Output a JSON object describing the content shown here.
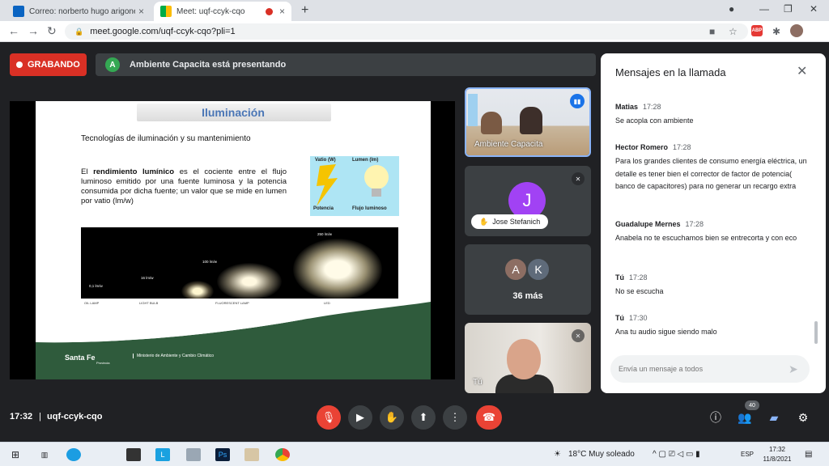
{
  "browser": {
    "tabs": [
      {
        "title": "Correo: norberto hugo arigone -",
        "active": false
      },
      {
        "title": "Meet: uqf-ccyk-cqo",
        "active": true
      }
    ],
    "url": "meet.google.com/uqf-ccyk-cqo?pli=1",
    "abp_label": "ABP"
  },
  "meet": {
    "recording_label": "GRABANDO",
    "presenter_initial": "A",
    "presenting_text": "Ambiente Capacita está presentando",
    "slide": {
      "title": "Iluminación",
      "subtitle": "Tecnologías de iluminación y su mantenimiento",
      "body_prefix": "El ",
      "body_bold": "rendimiento lumínico",
      "body_rest": " es el cociente entre el flujo luminoso emitido por una fuente luminosa y la potencia consumida por dicha fuente; un valor que se mide en lumen por vatio (lm/w)",
      "diagram": {
        "watts": "Vatio (W)",
        "lumen": "Lumen (lm)",
        "power": "Potencia",
        "flux": "Flujo luminoso"
      },
      "lamps": {
        "values": [
          "0,1 lm/w",
          "16 lm/w",
          "100 lm/w",
          "250 lm/w"
        ],
        "names": [
          "OIL LAMP",
          "LIGHT BULB",
          "FLUORESCENT LAMP",
          "LED"
        ]
      },
      "footer_logo": "Santa Fe",
      "footer_logo_sub": "Provincia",
      "footer_ministry": "Ministerio de Ambiente y Cambio Climático"
    },
    "tiles": [
      {
        "label": "Ambiente Capacita"
      },
      {
        "initial": "J",
        "name": "Jose Stefanich"
      },
      {
        "initials": [
          "A",
          "K"
        ],
        "more": "36 más"
      },
      {
        "label": "Tú"
      }
    ],
    "chat": {
      "title": "Mensajes en la llamada",
      "messages": [
        {
          "sender": "Matias",
          "time": "17:28",
          "text": "Se acopla con ambiente"
        },
        {
          "sender": "Hector Romero",
          "time": "17:28",
          "text": "Para los grandes clientes de consumo energía eléctrica, un detalle es tener bien el corrector de factor de potencia( banco de capacitores) para no generar un recargo extra"
        },
        {
          "sender": "Guadalupe Mernes",
          "time": "17:28",
          "text": "Anabela no te escuchamos bien se entrecorta y con eco"
        },
        {
          "sender": "Tú",
          "time": "17:28",
          "text": "No se escucha"
        },
        {
          "sender": "Tú",
          "time": "17:30",
          "text": "Ana tu audio sigue siendo malo"
        }
      ],
      "input_placeholder": "Envía un mensaje a todos"
    },
    "bottom": {
      "time": "17:32",
      "separator": "|",
      "meeting_code": "uqf-ccyk-cqo",
      "participant_count": "40"
    }
  },
  "taskbar": {
    "weather": "18°C  Muy soleado",
    "lang": "ESP",
    "clock_time": "17:32",
    "clock_date": "11/8/2021"
  },
  "colors": {
    "record_red": "#d93025",
    "meet_bg": "#202124",
    "tile_bg": "#3c4043",
    "speaking_border": "#8ab4f8"
  }
}
